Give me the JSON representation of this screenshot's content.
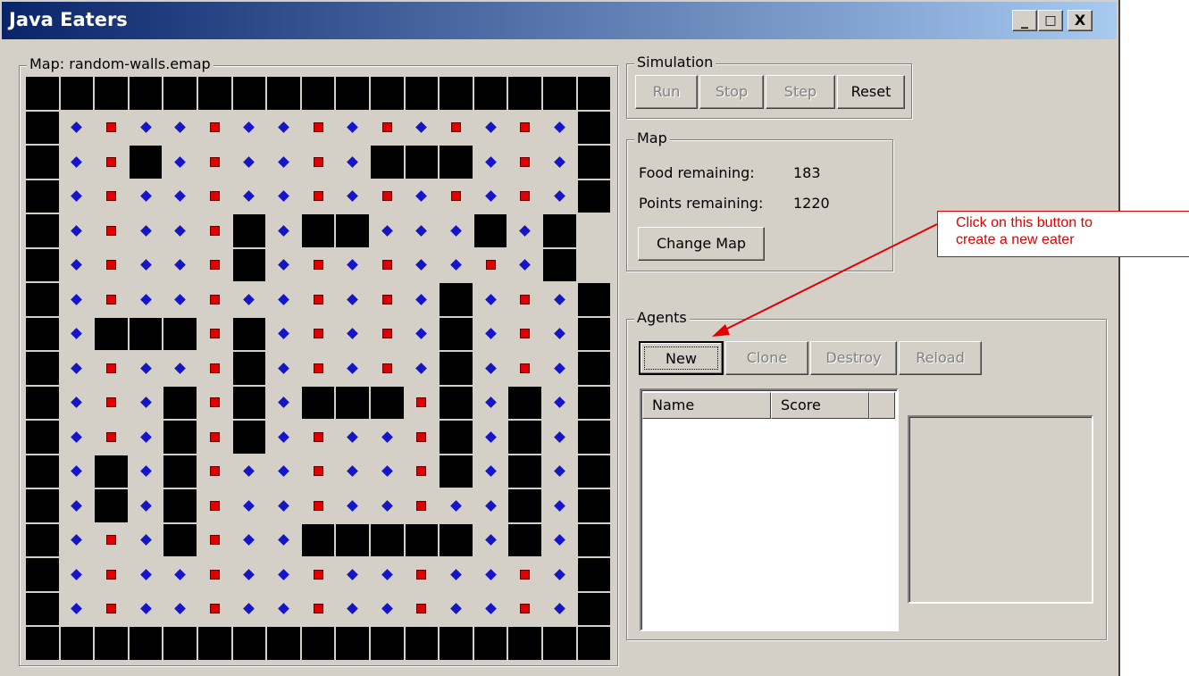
{
  "window": {
    "title": "Java Eaters",
    "buttons": {
      "minimize": "_",
      "maximize": "□",
      "close": "X"
    }
  },
  "map_panel": {
    "legend": "Map: random-walls.emap",
    "grid": {
      "cols": 17,
      "rows": 17,
      "legend_cell": {
        "#": "wall",
        "b": "blue-food",
        "r": "red-food",
        ".": "empty"
      },
      "cells": [
        "#################",
        "#brbbrbbrbrbrbrb#",
        "#br#brbbrb###brb#",
        "#brbbrbbrbrbrbrb#",
        "#brbbr#b##bbb#b#",
        "#brbbr#brbrbbrb#",
        "#brbbrbbrbrb#brb#",
        "#b###r#brbrb#brb#",
        "#brbbr#brbrb#brb#",
        "#brb#r#b###r#b#b#",
        "#brb#r#brbbr#b#b#",
        "#b#b#rbbrbbr#b#b#",
        "#b#b#rbbrbbrbb#b#",
        "#brb#rbb#####b#b#",
        "#brbbrbbrbbrbbrb#",
        "#brbbrbbrbbrbbrb#",
        "#################"
      ]
    }
  },
  "simulation": {
    "legend": "Simulation",
    "buttons": [
      {
        "label": "Run",
        "enabled": false
      },
      {
        "label": "Stop",
        "enabled": false
      },
      {
        "label": "Step",
        "enabled": false
      },
      {
        "label": "Reset",
        "enabled": true
      }
    ]
  },
  "map_info": {
    "legend": "Map",
    "food_label": "Food remaining:",
    "food_value": "183",
    "points_label": "Points remaining:",
    "points_value": "1220",
    "change_map": "Change Map"
  },
  "agents": {
    "legend": "Agents",
    "buttons": [
      {
        "label": "New",
        "enabled": true
      },
      {
        "label": "Clone",
        "enabled": false
      },
      {
        "label": "Destroy",
        "enabled": false
      },
      {
        "label": "Reload",
        "enabled": false
      }
    ],
    "columns": [
      "Name",
      "Score"
    ],
    "rows": []
  },
  "annotation": {
    "text_line1": "Click on this button to",
    "text_line2": "create a new eater",
    "color": "#e00000"
  },
  "colors": {
    "window_bg": "#d4d0c8",
    "wall": "#000000",
    "blue_food": "#1414c8",
    "red_food": "#e00000"
  }
}
